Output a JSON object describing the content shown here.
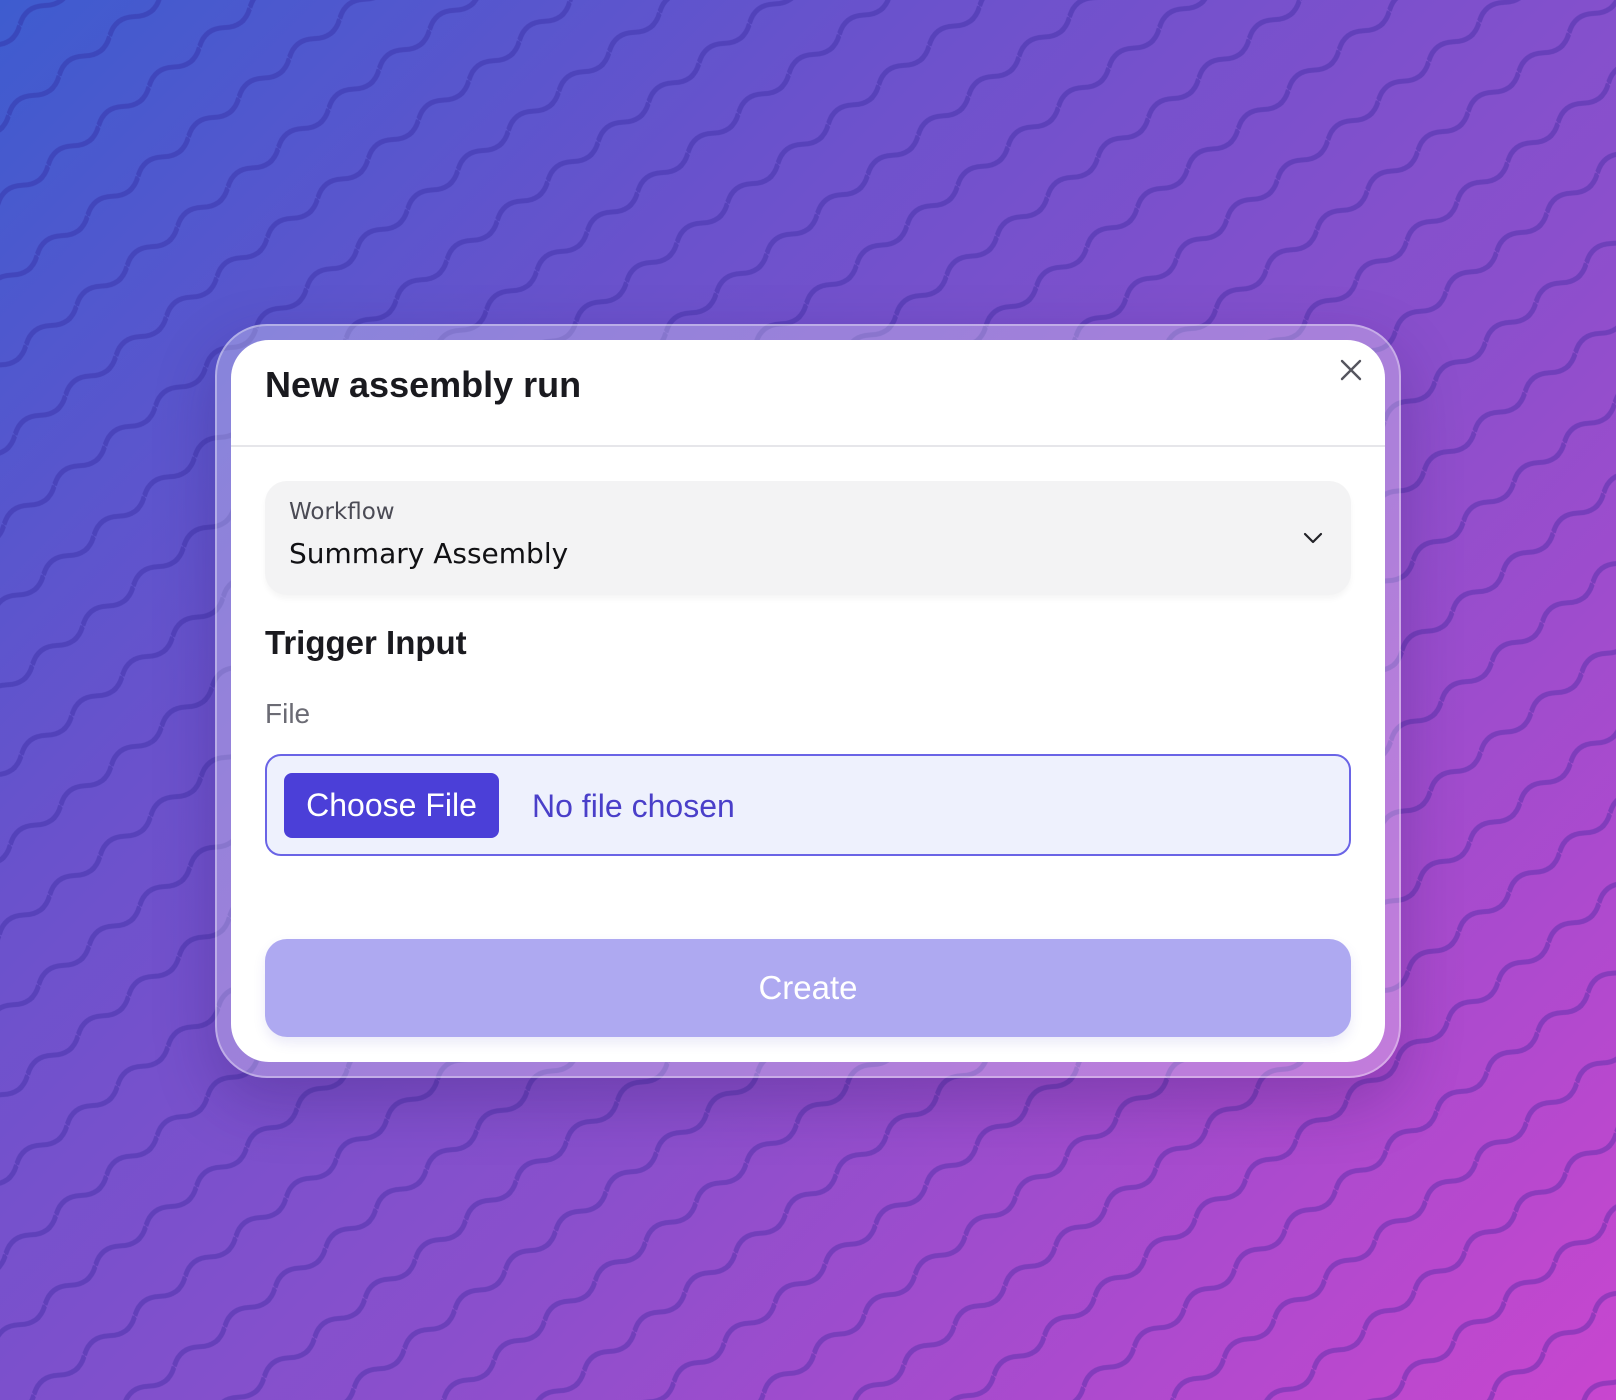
{
  "colors": {
    "accent": "#4b3fd8",
    "accent_text": "#4a3fc9",
    "create_button_disabled": "#aea9f1",
    "file_input_bg": "#eef1fd",
    "file_input_border": "#6a64e6",
    "select_bg": "#f3f3f4"
  },
  "modal": {
    "title": "New assembly run",
    "close_icon": "close-icon"
  },
  "workflow_select": {
    "label": "Workflow",
    "value": "Summary Assembly",
    "icon": "chevron-down-icon"
  },
  "trigger_input": {
    "title": "Trigger Input",
    "file_label": "File",
    "choose_button_label": "Choose File",
    "status_text": "No file chosen"
  },
  "actions": {
    "create_label": "Create"
  }
}
